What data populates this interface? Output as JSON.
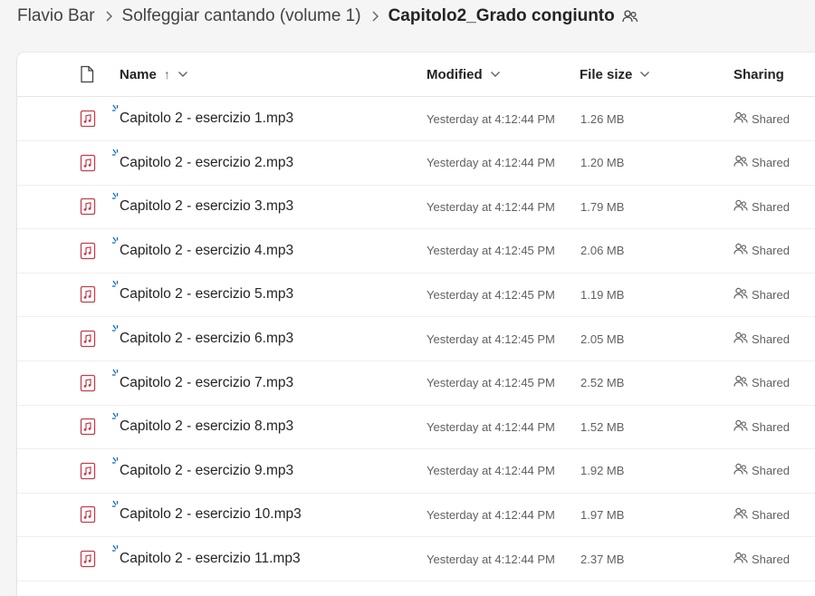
{
  "breadcrumb": {
    "items": [
      "Flavio Bar",
      "Solfeggiar cantando (volume 1)"
    ],
    "current": "Capitolo2_Grado congiunto"
  },
  "table": {
    "headers": {
      "name": "Name",
      "name_sort_arrow": "↑",
      "modified": "Modified",
      "file_size": "File size",
      "sharing": "Sharing"
    },
    "rows": [
      {
        "name": "Capitolo 2 - esercizio 1.mp3",
        "modified": "Yesterday at 4:12:44 PM",
        "size": "1.26 MB",
        "sharing": "Shared"
      },
      {
        "name": "Capitolo 2 - esercizio 2.mp3",
        "modified": "Yesterday at 4:12:44 PM",
        "size": "1.20 MB",
        "sharing": "Shared"
      },
      {
        "name": "Capitolo 2 - esercizio 3.mp3",
        "modified": "Yesterday at 4:12:44 PM",
        "size": "1.79 MB",
        "sharing": "Shared"
      },
      {
        "name": "Capitolo 2 - esercizio 4.mp3",
        "modified": "Yesterday at 4:12:45 PM",
        "size": "2.06 MB",
        "sharing": "Shared"
      },
      {
        "name": "Capitolo 2 - esercizio 5.mp3",
        "modified": "Yesterday at 4:12:45 PM",
        "size": "1.19 MB",
        "sharing": "Shared"
      },
      {
        "name": "Capitolo 2 - esercizio 6.mp3",
        "modified": "Yesterday at 4:12:45 PM",
        "size": "2.05 MB",
        "sharing": "Shared"
      },
      {
        "name": "Capitolo 2 - esercizio 7.mp3",
        "modified": "Yesterday at 4:12:45 PM",
        "size": "2.52 MB",
        "sharing": "Shared"
      },
      {
        "name": "Capitolo 2 - esercizio 8.mp3",
        "modified": "Yesterday at 4:12:44 PM",
        "size": "1.52 MB",
        "sharing": "Shared"
      },
      {
        "name": "Capitolo 2 - esercizio 9.mp3",
        "modified": "Yesterday at 4:12:44 PM",
        "size": "1.92 MB",
        "sharing": "Shared"
      },
      {
        "name": "Capitolo 2 - esercizio 10.mp3",
        "modified": "Yesterday at 4:12:44 PM",
        "size": "1.97 MB",
        "sharing": "Shared"
      },
      {
        "name": "Capitolo 2 - esercizio 11.mp3",
        "modified": "Yesterday at 4:12:44 PM",
        "size": "2.37 MB",
        "sharing": "Shared"
      }
    ]
  },
  "icons": {
    "header_file": "document-icon",
    "row_file": "audio-file-icon",
    "new_indicator": "new-item-sparkle-icon",
    "sharing": "people-icon",
    "separator": "chevron-right-icon",
    "sort_menu": "chevron-down-icon"
  },
  "colors": {
    "audio_icon": "#c43e4c",
    "new_indicator": "#0f6cbd",
    "secondary_text": "#616161"
  }
}
